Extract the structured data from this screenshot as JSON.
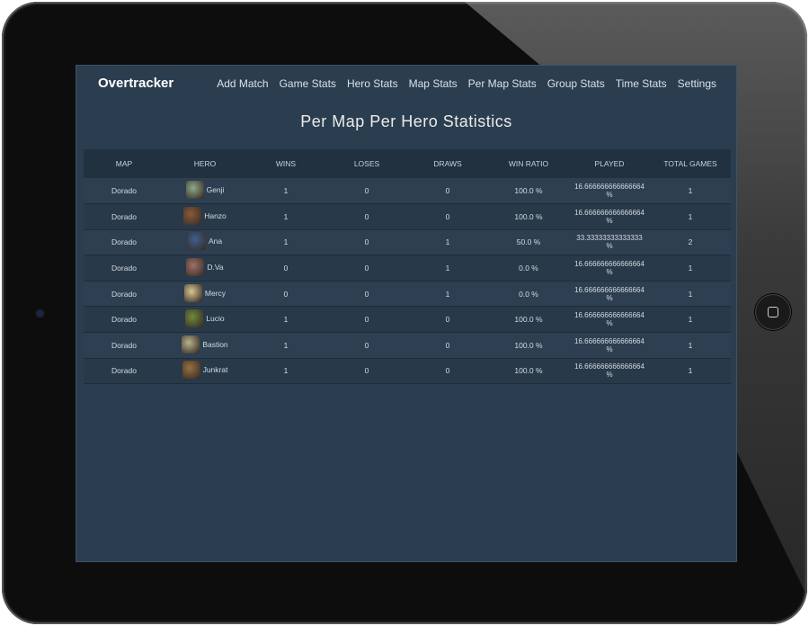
{
  "app": {
    "name": "Overtracker"
  },
  "nav": [
    "Add Match",
    "Game Stats",
    "Hero Stats",
    "Map Stats",
    "Per Map Stats",
    "Group Stats",
    "Time Stats",
    "Settings"
  ],
  "page": {
    "title": "Per Map Per Hero Statistics"
  },
  "table": {
    "headers": [
      "MAP",
      "HERO",
      "WINS",
      "LOSES",
      "DRAWS",
      "WIN RATIO",
      "PLAYED",
      "TOTAL GAMES"
    ],
    "rows": [
      {
        "map": "Dorado",
        "hero": "Genji",
        "icon_color": "#8fa88a",
        "wins": "1",
        "loses": "0",
        "draws": "0",
        "win_ratio": "100.0 %",
        "played": "16.666666666666664 %",
        "total": "1"
      },
      {
        "map": "Dorado",
        "hero": "Hanzo",
        "icon_color": "#8a5a3a",
        "wins": "1",
        "loses": "0",
        "draws": "0",
        "win_ratio": "100.0 %",
        "played": "16.666666666666664 %",
        "total": "1"
      },
      {
        "map": "Dorado",
        "hero": "Ana",
        "icon_color": "#3b5f8f",
        "wins": "1",
        "loses": "0",
        "draws": "1",
        "win_ratio": "50.0 %",
        "played": "33.33333333333333 %",
        "total": "2"
      },
      {
        "map": "Dorado",
        "hero": "D.Va",
        "icon_color": "#a0706a",
        "wins": "0",
        "loses": "0",
        "draws": "1",
        "win_ratio": "0.0 %",
        "played": "16.666666666666664 %",
        "total": "1"
      },
      {
        "map": "Dorado",
        "hero": "Mercy",
        "icon_color": "#d8c890",
        "wins": "0",
        "loses": "0",
        "draws": "1",
        "win_ratio": "0.0 %",
        "played": "16.666666666666664 %",
        "total": "1"
      },
      {
        "map": "Dorado",
        "hero": "Lucio",
        "icon_color": "#6f8a3a",
        "wins": "1",
        "loses": "0",
        "draws": "0",
        "win_ratio": "100.0 %",
        "played": "16.666666666666664 %",
        "total": "1"
      },
      {
        "map": "Dorado",
        "hero": "Bastion",
        "icon_color": "#b8b38a",
        "wins": "1",
        "loses": "0",
        "draws": "0",
        "win_ratio": "100.0 %",
        "played": "16.666666666666664 %",
        "total": "1"
      },
      {
        "map": "Dorado",
        "hero": "Junkrat",
        "icon_color": "#9a7040",
        "wins": "1",
        "loses": "0",
        "draws": "0",
        "win_ratio": "100.0 %",
        "played": "16.666666666666664 %",
        "total": "1"
      }
    ]
  }
}
